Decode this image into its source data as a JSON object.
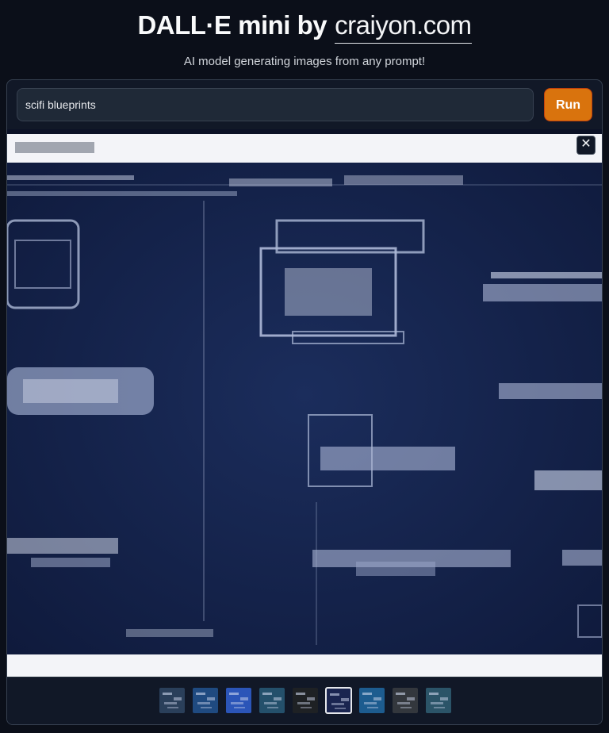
{
  "header": {
    "title_prefix": "DALL·E mini by",
    "title_link": "craiyon.com",
    "subtitle": "AI model generating images from any prompt!"
  },
  "prompt": {
    "value": "scifi blueprints"
  },
  "run_button": {
    "label": "Run"
  },
  "gallery": {
    "close_icon": "close-icon",
    "close_glyph": "✕",
    "selected_index": 5,
    "thumbnails": [
      {
        "name": "thumbnail-1",
        "color": "#2a3f5a"
      },
      {
        "name": "thumbnail-2",
        "color": "#1f4a80"
      },
      {
        "name": "thumbnail-3",
        "color": "#2b55b8"
      },
      {
        "name": "thumbnail-4",
        "color": "#24506b"
      },
      {
        "name": "thumbnail-5",
        "color": "#1e2124"
      },
      {
        "name": "thumbnail-6",
        "color": "#1a2550"
      },
      {
        "name": "thumbnail-7",
        "color": "#1d5c8f"
      },
      {
        "name": "thumbnail-8",
        "color": "#33373d"
      },
      {
        "name": "thumbnail-9",
        "color": "#2b5468"
      }
    ]
  }
}
